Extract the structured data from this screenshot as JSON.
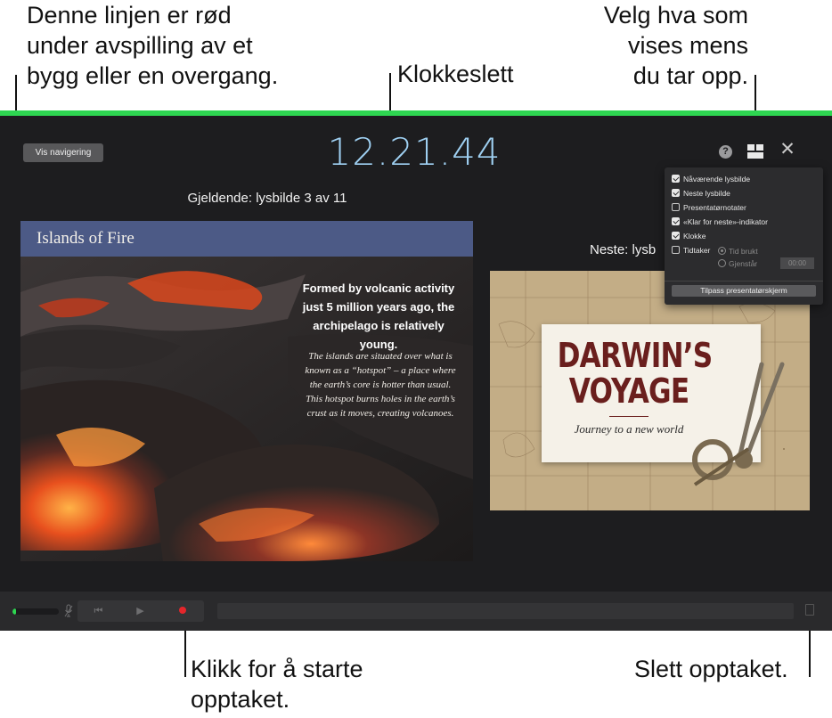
{
  "callouts": {
    "build_line": [
      "Denne linjen er rød",
      "under avspilling av et",
      "bygg eller en overgang."
    ],
    "clock": "Klokkeslett",
    "choose_display": [
      "Velg hva som",
      "vises mens",
      "du tar opp."
    ],
    "start_recording": [
      "Klikk for å starte",
      "opptaket."
    ],
    "delete_recording": "Slett opptaket."
  },
  "presenter": {
    "nav_button": "Vis navigering",
    "clock_time": "12.21.44",
    "current_label": "Gjeldende: lysbilde 3 av 11",
    "next_label": "Neste: lysb",
    "recording_bar_color": "#2ed651"
  },
  "current_slide": {
    "title": "Islands of Fire",
    "lead_text": "Formed by volcanic activity just 5 million years ago, the archipelago is relatively young.",
    "body_text": "The islands are situated over what is known as a “hotspot” – a place where the earth’s core is hotter than usual. This hotspot burns holes in the earth’s crust as it moves, creating volcanoes."
  },
  "next_slide": {
    "title": "DARWIN’S VOYAGE",
    "subtitle": "Journey to a new world"
  },
  "display_menu": {
    "items": [
      {
        "label": "Nåværende lysbilde",
        "checked": true
      },
      {
        "label": "Neste lysbilde",
        "checked": true
      },
      {
        "label": "Presentatørnotater",
        "checked": false
      },
      {
        "label": "«Klar for neste»-indikator",
        "checked": true
      },
      {
        "label": "Klokke",
        "checked": true
      },
      {
        "label": "Tidtaker",
        "checked": false
      }
    ],
    "timer_options": [
      {
        "label": "Tid brukt",
        "selected": true
      },
      {
        "label": "Gjenstår",
        "selected": false
      }
    ],
    "timer_value": "00:00",
    "fit_button": "Tilpass presentatørskjerm"
  },
  "toolbar": {
    "audio_level": 0.08,
    "icons": [
      "microphone-muted-icon",
      "skip-back-icon",
      "play-icon",
      "record-icon",
      "trash-icon"
    ]
  }
}
